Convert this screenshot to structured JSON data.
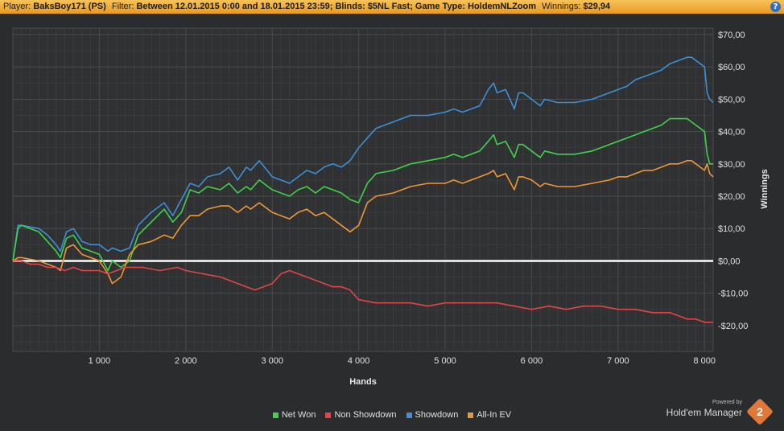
{
  "header": {
    "player_label": "Player:",
    "player_value": "BaksBoy171 (PS)",
    "filter_label": "Filter:",
    "filter_value": "Between 12.01.2015 0:00 and 18.01.2015 23:59; Blinds: $5NL Fast; Game Type: HoldemNLZoom",
    "winnings_label": "Winnings:",
    "winnings_value": "$29,94",
    "help_glyph": "?"
  },
  "brand": {
    "powered_by": "Powered by",
    "name": "Hold'em Manager",
    "logo_number": "2"
  },
  "chart_data": {
    "type": "line",
    "title": "",
    "xlabel": "Hands",
    "ylabel": "Winnings",
    "xlim": [
      0,
      8100
    ],
    "ylim": [
      -28,
      72
    ],
    "x_ticks": [
      1000,
      2000,
      3000,
      4000,
      5000,
      6000,
      7000,
      8000
    ],
    "x_tick_labels": [
      "1 000",
      "2 000",
      "3 000",
      "4 000",
      "5 000",
      "6 000",
      "7 000",
      "8 000"
    ],
    "y_ticks": [
      -20,
      -10,
      0,
      10,
      20,
      30,
      40,
      50,
      60,
      70
    ],
    "y_tick_labels": [
      "-$20,00",
      "-$10,00",
      "$0,00",
      "$10,00",
      "$20,00",
      "$30,00",
      "$40,00",
      "$50,00",
      "$60,00",
      "$70,00"
    ],
    "grid": true,
    "legend_position": "bottom",
    "series": [
      {
        "name": "Showdown",
        "color": "#3d8fd6",
        "x": [
          0,
          60,
          100,
          300,
          400,
          500,
          550,
          620,
          700,
          800,
          900,
          1000,
          1100,
          1150,
          1250,
          1350,
          1450,
          1600,
          1750,
          1850,
          1950,
          2050,
          2150,
          2250,
          2400,
          2500,
          2600,
          2700,
          2750,
          2850,
          3000,
          3100,
          3200,
          3300,
          3400,
          3500,
          3600,
          3700,
          3800,
          3900,
          4000,
          4100,
          4200,
          4400,
          4600,
          4800,
          5000,
          5100,
          5200,
          5300,
          5400,
          5500,
          5560,
          5600,
          5700,
          5800,
          5850,
          5900,
          6000,
          6100,
          6150,
          6300,
          6500,
          6700,
          6900,
          7000,
          7100,
          7200,
          7300,
          7400,
          7500,
          7600,
          7700,
          7800,
          7850,
          7900,
          7950,
          8000,
          8030,
          8060,
          8100
        ],
        "values": [
          0,
          11,
          11,
          10,
          8,
          5,
          3,
          9,
          10,
          6,
          5,
          5,
          3,
          4,
          3,
          4,
          11,
          15,
          18,
          14,
          19,
          24,
          23,
          26,
          27,
          29,
          25,
          29,
          28,
          31,
          26,
          25,
          24,
          26,
          28,
          27,
          29,
          30,
          29,
          31,
          35,
          38,
          41,
          43,
          45,
          45,
          46,
          47,
          46,
          47,
          48,
          53,
          55,
          52,
          53,
          47,
          52,
          52,
          50,
          48,
          50,
          49,
          49,
          50,
          52,
          53,
          54,
          56,
          57,
          58,
          59,
          61,
          62,
          63,
          63,
          62,
          61,
          60,
          52,
          50,
          49
        ]
      },
      {
        "name": "Net Won",
        "color": "#3fd24a",
        "x": [
          0,
          60,
          100,
          300,
          400,
          500,
          550,
          620,
          700,
          800,
          900,
          1000,
          1100,
          1150,
          1250,
          1350,
          1450,
          1600,
          1750,
          1850,
          1950,
          2050,
          2150,
          2250,
          2400,
          2500,
          2600,
          2700,
          2750,
          2850,
          3000,
          3100,
          3200,
          3300,
          3400,
          3500,
          3600,
          3700,
          3800,
          3900,
          4000,
          4100,
          4200,
          4400,
          4600,
          4800,
          5000,
          5100,
          5200,
          5300,
          5400,
          5500,
          5560,
          5600,
          5700,
          5800,
          5850,
          5900,
          6000,
          6100,
          6150,
          6300,
          6500,
          6700,
          6900,
          7000,
          7100,
          7200,
          7300,
          7400,
          7500,
          7600,
          7700,
          7800,
          7850,
          7900,
          7950,
          8000,
          8030,
          8060,
          8100
        ],
        "values": [
          0,
          10,
          11,
          9,
          6,
          3,
          1,
          7,
          8,
          4,
          3,
          2,
          -3,
          0,
          -2,
          0,
          8,
          12,
          16,
          12,
          15,
          22,
          21,
          23,
          22,
          24,
          21,
          23,
          22,
          25,
          22,
          21,
          20,
          22,
          23,
          21,
          23,
          22,
          21,
          19,
          18,
          24,
          27,
          28,
          30,
          31,
          32,
          33,
          32,
          33,
          34,
          37,
          39,
          36,
          37,
          32,
          36,
          36,
          34,
          32,
          34,
          33,
          33,
          34,
          36,
          37,
          38,
          39,
          40,
          41,
          42,
          44,
          44,
          44,
          43,
          42,
          41,
          40,
          33,
          30,
          30
        ]
      },
      {
        "name": "All-In EV",
        "color": "#ef9636",
        "x": [
          0,
          60,
          100,
          300,
          400,
          500,
          550,
          620,
          700,
          800,
          900,
          1000,
          1100,
          1150,
          1250,
          1350,
          1450,
          1600,
          1750,
          1850,
          1950,
          2050,
          2150,
          2250,
          2400,
          2500,
          2600,
          2700,
          2750,
          2850,
          3000,
          3100,
          3200,
          3300,
          3400,
          3500,
          3600,
          3700,
          3800,
          3900,
          4000,
          4100,
          4200,
          4400,
          4600,
          4800,
          5000,
          5100,
          5200,
          5300,
          5400,
          5500,
          5560,
          5600,
          5700,
          5800,
          5850,
          5900,
          6000,
          6100,
          6150,
          6300,
          6500,
          6700,
          6900,
          7000,
          7100,
          7200,
          7300,
          7400,
          7500,
          7600,
          7700,
          7800,
          7850,
          7900,
          7950,
          8000,
          8030,
          8060,
          8100
        ],
        "values": [
          0,
          1,
          1,
          0,
          -1,
          -2,
          -3,
          4,
          5,
          2,
          1,
          0,
          -4,
          -7,
          -5,
          2,
          5,
          6,
          8,
          7,
          11,
          14,
          14,
          16,
          17,
          17,
          15,
          17,
          16,
          18,
          15,
          14,
          13,
          15,
          16,
          14,
          15,
          13,
          11,
          9,
          11,
          18,
          20,
          21,
          23,
          24,
          24,
          25,
          24,
          25,
          26,
          27,
          28,
          26,
          27,
          22,
          26,
          26,
          25,
          23,
          24,
          23,
          23,
          24,
          25,
          26,
          26,
          27,
          28,
          28,
          29,
          30,
          30,
          31,
          31,
          30,
          29,
          28,
          30,
          27,
          26
        ]
      },
      {
        "name": "Non Showdown",
        "color": "#e0454a",
        "x": [
          0,
          100,
          200,
          300,
          400,
          500,
          600,
          700,
          800,
          900,
          1000,
          1100,
          1200,
          1300,
          1500,
          1700,
          1900,
          2000,
          2200,
          2400,
          2600,
          2700,
          2800,
          2900,
          3000,
          3100,
          3200,
          3300,
          3400,
          3500,
          3600,
          3700,
          3800,
          3900,
          4000,
          4200,
          4400,
          4600,
          4800,
          5000,
          5200,
          5400,
          5600,
          5800,
          6000,
          6200,
          6400,
          6600,
          6800,
          7000,
          7200,
          7400,
          7600,
          7700,
          7800,
          7900,
          8000,
          8100
        ],
        "values": [
          0,
          0,
          -1,
          -1,
          -2,
          -2,
          -3,
          -2,
          -3,
          -3,
          -3,
          -4,
          -3,
          -2,
          -2,
          -3,
          -2,
          -3,
          -4,
          -5,
          -7,
          -8,
          -9,
          -8,
          -7,
          -4,
          -3,
          -4,
          -5,
          -6,
          -7,
          -8,
          -8,
          -9,
          -12,
          -13,
          -13,
          -13,
          -14,
          -13,
          -13,
          -13,
          -13,
          -14,
          -15,
          -14,
          -15,
          -14,
          -14,
          -15,
          -15,
          -16,
          -16,
          -17,
          -18,
          -18,
          -19,
          -19
        ]
      }
    ],
    "legend_order": [
      "Net Won",
      "Non Showdown",
      "Showdown",
      "All-In EV"
    ]
  }
}
